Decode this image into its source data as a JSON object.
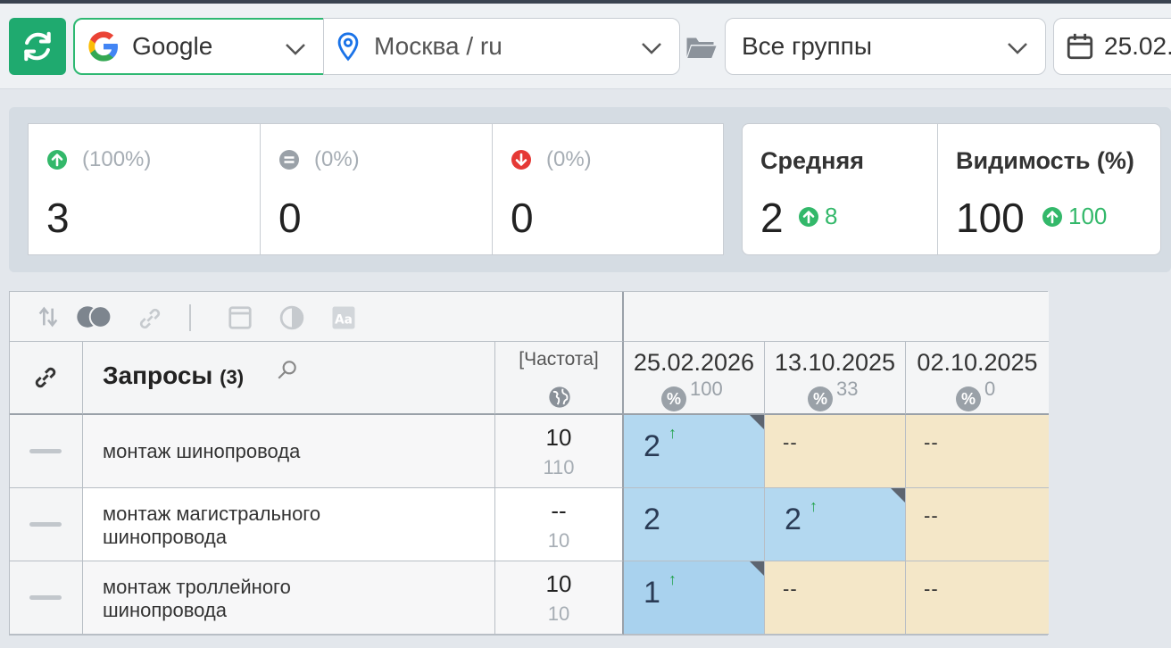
{
  "toolbar": {
    "engine": "Google",
    "region": "Москва / ru",
    "group": "Все группы",
    "date": "25.02."
  },
  "stats": {
    "up": {
      "pct": "(100%)",
      "count": "3"
    },
    "same": {
      "pct": "(0%)",
      "count": "0"
    },
    "down": {
      "pct": "(0%)",
      "count": "0"
    }
  },
  "summary": {
    "avg": {
      "title": "Средняя",
      "value": "2",
      "delta": "8"
    },
    "visibility": {
      "title": "Видимость (%)",
      "value": "100",
      "delta": "100"
    }
  },
  "table": {
    "queries_label": "Запросы",
    "queries_count": "(3)",
    "freq_label": "[Частота]",
    "dates": [
      {
        "date": "25.02.2026",
        "visibility": "100"
      },
      {
        "date": "13.10.2025",
        "visibility": "33"
      },
      {
        "date": "02.10.2025",
        "visibility": "0"
      }
    ],
    "rows": [
      {
        "query": "монтаж шинопровода",
        "freq": "10",
        "freq_sub": "110",
        "positions": [
          "2",
          "--",
          "--"
        ]
      },
      {
        "query": "монтаж магистрального шинопровода",
        "freq": "--",
        "freq_sub": "10",
        "positions": [
          "2",
          "2",
          "--"
        ]
      },
      {
        "query": "монтаж троллейного шинопровода",
        "freq": "10",
        "freq_sub": "10",
        "positions": [
          "1",
          "--",
          "--"
        ]
      }
    ]
  }
}
